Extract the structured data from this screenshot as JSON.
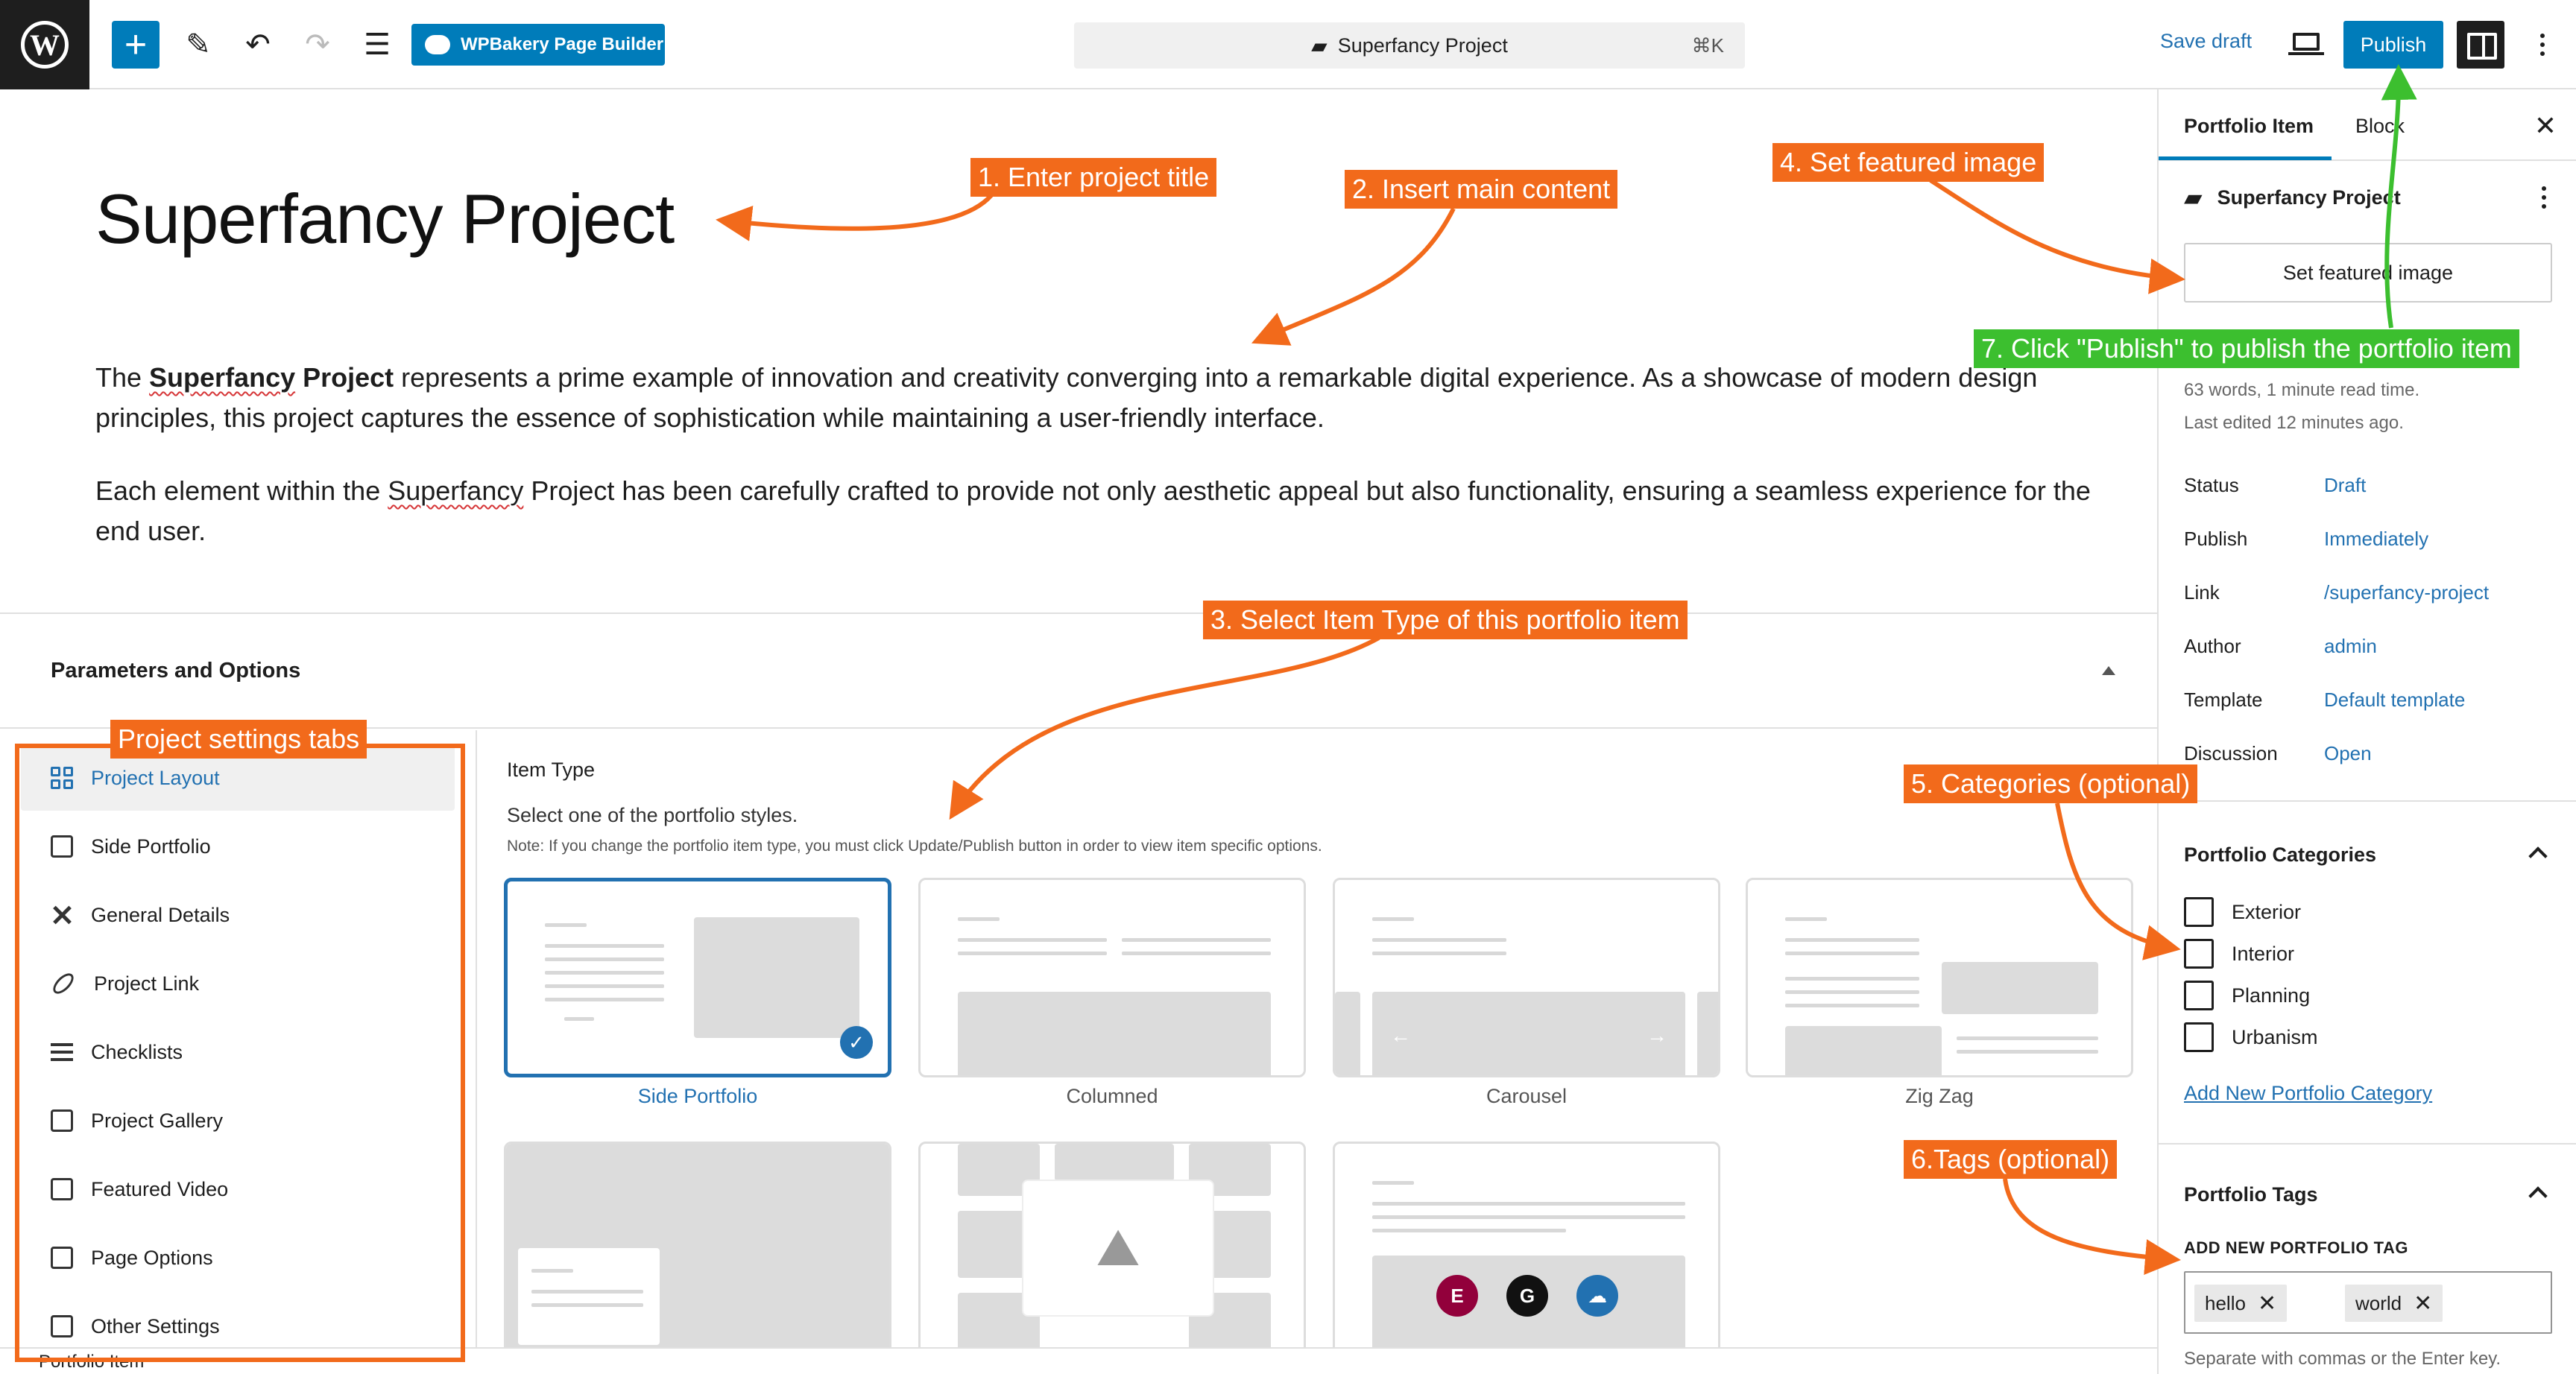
{
  "topbar": {
    "wpbakery_label": "WPBakery Page Builder",
    "command_title": "Superfancy Project",
    "command_shortcut": "⌘K",
    "save_draft": "Save draft",
    "publish": "Publish"
  },
  "editor": {
    "title": "Superfancy Project",
    "p1_pre": "The ",
    "p1_bold_a": "Superfancy",
    "p1_bold_b": " Project",
    "p1_post": " represents a prime example of innovation and creativity converging into a remarkable digital experience. As a showcase of modern design principles, this project captures the essence of sophistication while maintaining a user-friendly interface.",
    "p2_pre": "Each element within the ",
    "p2_word": "Superfancy",
    "p2_post": " Project has been carefully crafted to provide not only aesthetic appeal but also functionality, ensuring a seamless experience for the end user."
  },
  "params": {
    "title": "Parameters and Options",
    "tabs": [
      {
        "label": "Project Layout"
      },
      {
        "label": "Side Portfolio"
      },
      {
        "label": "General Details"
      },
      {
        "label": "Project Link"
      },
      {
        "label": "Checklists"
      },
      {
        "label": "Project Gallery"
      },
      {
        "label": "Featured Video"
      },
      {
        "label": "Page Options"
      },
      {
        "label": "Other Settings"
      }
    ],
    "item_type_label": "Item Type",
    "item_type_desc": "Select one of the portfolio styles.",
    "item_type_note": "Note: If you change the portfolio item type, you must click Update/Publish button in order to view item specific options.",
    "styles": [
      "Side Portfolio",
      "Columned",
      "Carousel",
      "Zig Zag"
    ]
  },
  "sidebar": {
    "tab_portfolio": "Portfolio Item",
    "tab_block": "Block",
    "doc_title": "Superfancy Project",
    "featured_button": "Set featured image",
    "words": "63 words, 1 minute read time.",
    "edited": "Last edited 12 minutes ago.",
    "rows": [
      {
        "label": "Status",
        "value": "Draft"
      },
      {
        "label": "Publish",
        "value": "Immediately"
      },
      {
        "label": "Link",
        "value": "/superfancy-project"
      },
      {
        "label": "Author",
        "value": "admin"
      },
      {
        "label": "Template",
        "value": "Default template"
      },
      {
        "label": "Discussion",
        "value": "Open"
      }
    ],
    "categories_title": "Portfolio Categories",
    "categories": [
      "Exterior",
      "Interior",
      "Planning",
      "Urbanism"
    ],
    "add_category": "Add New Portfolio Category",
    "tags_title": "Portfolio Tags",
    "tags_label": "ADD NEW PORTFOLIO TAG",
    "tags": [
      "hello",
      "world"
    ],
    "tags_hint": "Separate with commas or the Enter key."
  },
  "statusbar": {
    "label": "Portfolio Item"
  },
  "annotations": {
    "a1": "1. Enter project title",
    "a2": "2. Insert main content",
    "a3": "3. Select Item Type of this portfolio item",
    "a4": "4. Set featured image",
    "a5": "5. Categories (optional)",
    "a6": "6.Tags (optional)",
    "a7": "7. Click \"Publish\" to publish the portfolio item",
    "tabs": "Project settings tabs"
  },
  "colors": {
    "accent": "#007cba",
    "annotation": "#f26a1b",
    "annotation_green": "#3cbf2f"
  }
}
